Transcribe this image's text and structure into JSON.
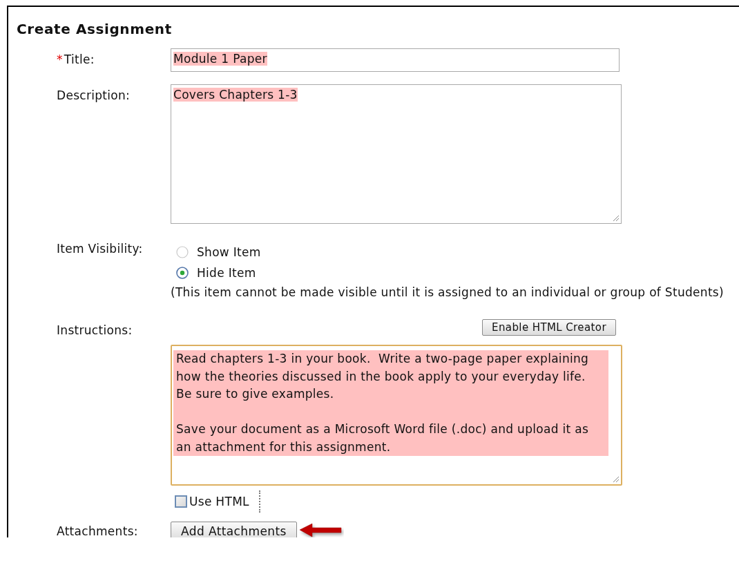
{
  "heading": "Create Assignment",
  "title_field": {
    "required_mark": "*",
    "label": "Title:",
    "value": "Module 1 Paper"
  },
  "description_field": {
    "label": "Description:",
    "value": "Covers Chapters 1-3"
  },
  "item_visibility": {
    "label": "Item Visibility:",
    "options": [
      {
        "label": "Show Item",
        "selected": false
      },
      {
        "label": "Hide Item",
        "selected": true
      }
    ],
    "note": "(This item cannot be made visible until it is assigned to an individual or group of Students)"
  },
  "instructions": {
    "label": "Instructions:",
    "button": "Enable HTML Creator",
    "paragraphs": [
      "Read chapters 1-3 in your book.  Write a two-page paper explaining how the theories discussed in the book apply to your everyday life.  Be sure to give examples.",
      "Save your document as a Microsoft Word file (.doc) and upload it as an attachment for this assignment."
    ],
    "use_html": {
      "label": "Use HTML",
      "checked": false
    }
  },
  "attachments": {
    "label": "Attachments:",
    "button": "Add Attachments"
  }
}
